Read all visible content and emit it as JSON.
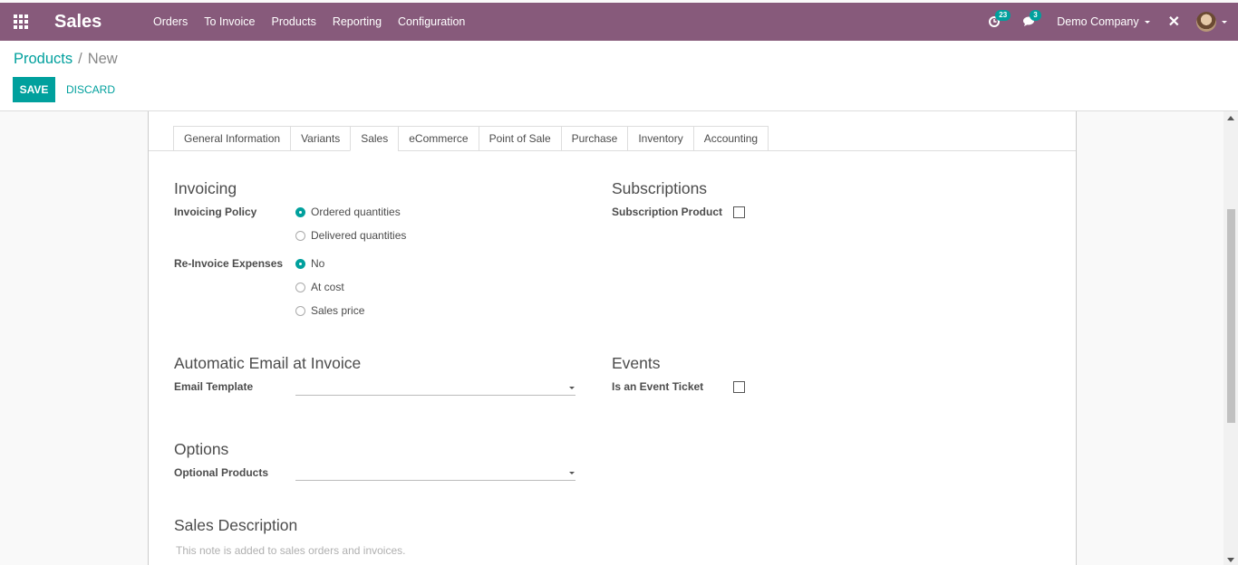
{
  "navbar": {
    "app_name": "Sales",
    "menu": [
      "Orders",
      "To Invoice",
      "Products",
      "Reporting",
      "Configuration"
    ],
    "activity_count": "23",
    "message_count": "3",
    "company": "Demo Company",
    "color": "#875a7b"
  },
  "breadcrumb": {
    "parent": "Products",
    "separator": "/",
    "current": "New"
  },
  "buttons": {
    "save": "SAVE",
    "discard": "DISCARD"
  },
  "tabs": [
    "General Information",
    "Variants",
    "Sales",
    "eCommerce",
    "Point of Sale",
    "Purchase",
    "Inventory",
    "Accounting"
  ],
  "active_tab": "Sales",
  "invoicing": {
    "title": "Invoicing",
    "policy_label": "Invoicing Policy",
    "policy_options": [
      "Ordered quantities",
      "Delivered quantities"
    ],
    "policy_selected": "Ordered quantities",
    "reinvoice_label": "Re-Invoice Expenses",
    "reinvoice_options": [
      "No",
      "At cost",
      "Sales price"
    ],
    "reinvoice_selected": "No"
  },
  "subscriptions": {
    "title": "Subscriptions",
    "label": "Subscription Product",
    "checked": false
  },
  "auto_email": {
    "title": "Automatic Email at Invoice",
    "label": "Email Template",
    "value": ""
  },
  "events": {
    "title": "Events",
    "label": "Is an Event Ticket",
    "checked": false
  },
  "options": {
    "title": "Options",
    "label": "Optional Products",
    "value": ""
  },
  "sales_description": {
    "title": "Sales Description",
    "placeholder": "This note is added to sales orders and invoices."
  },
  "accent_color": "#00a09d"
}
